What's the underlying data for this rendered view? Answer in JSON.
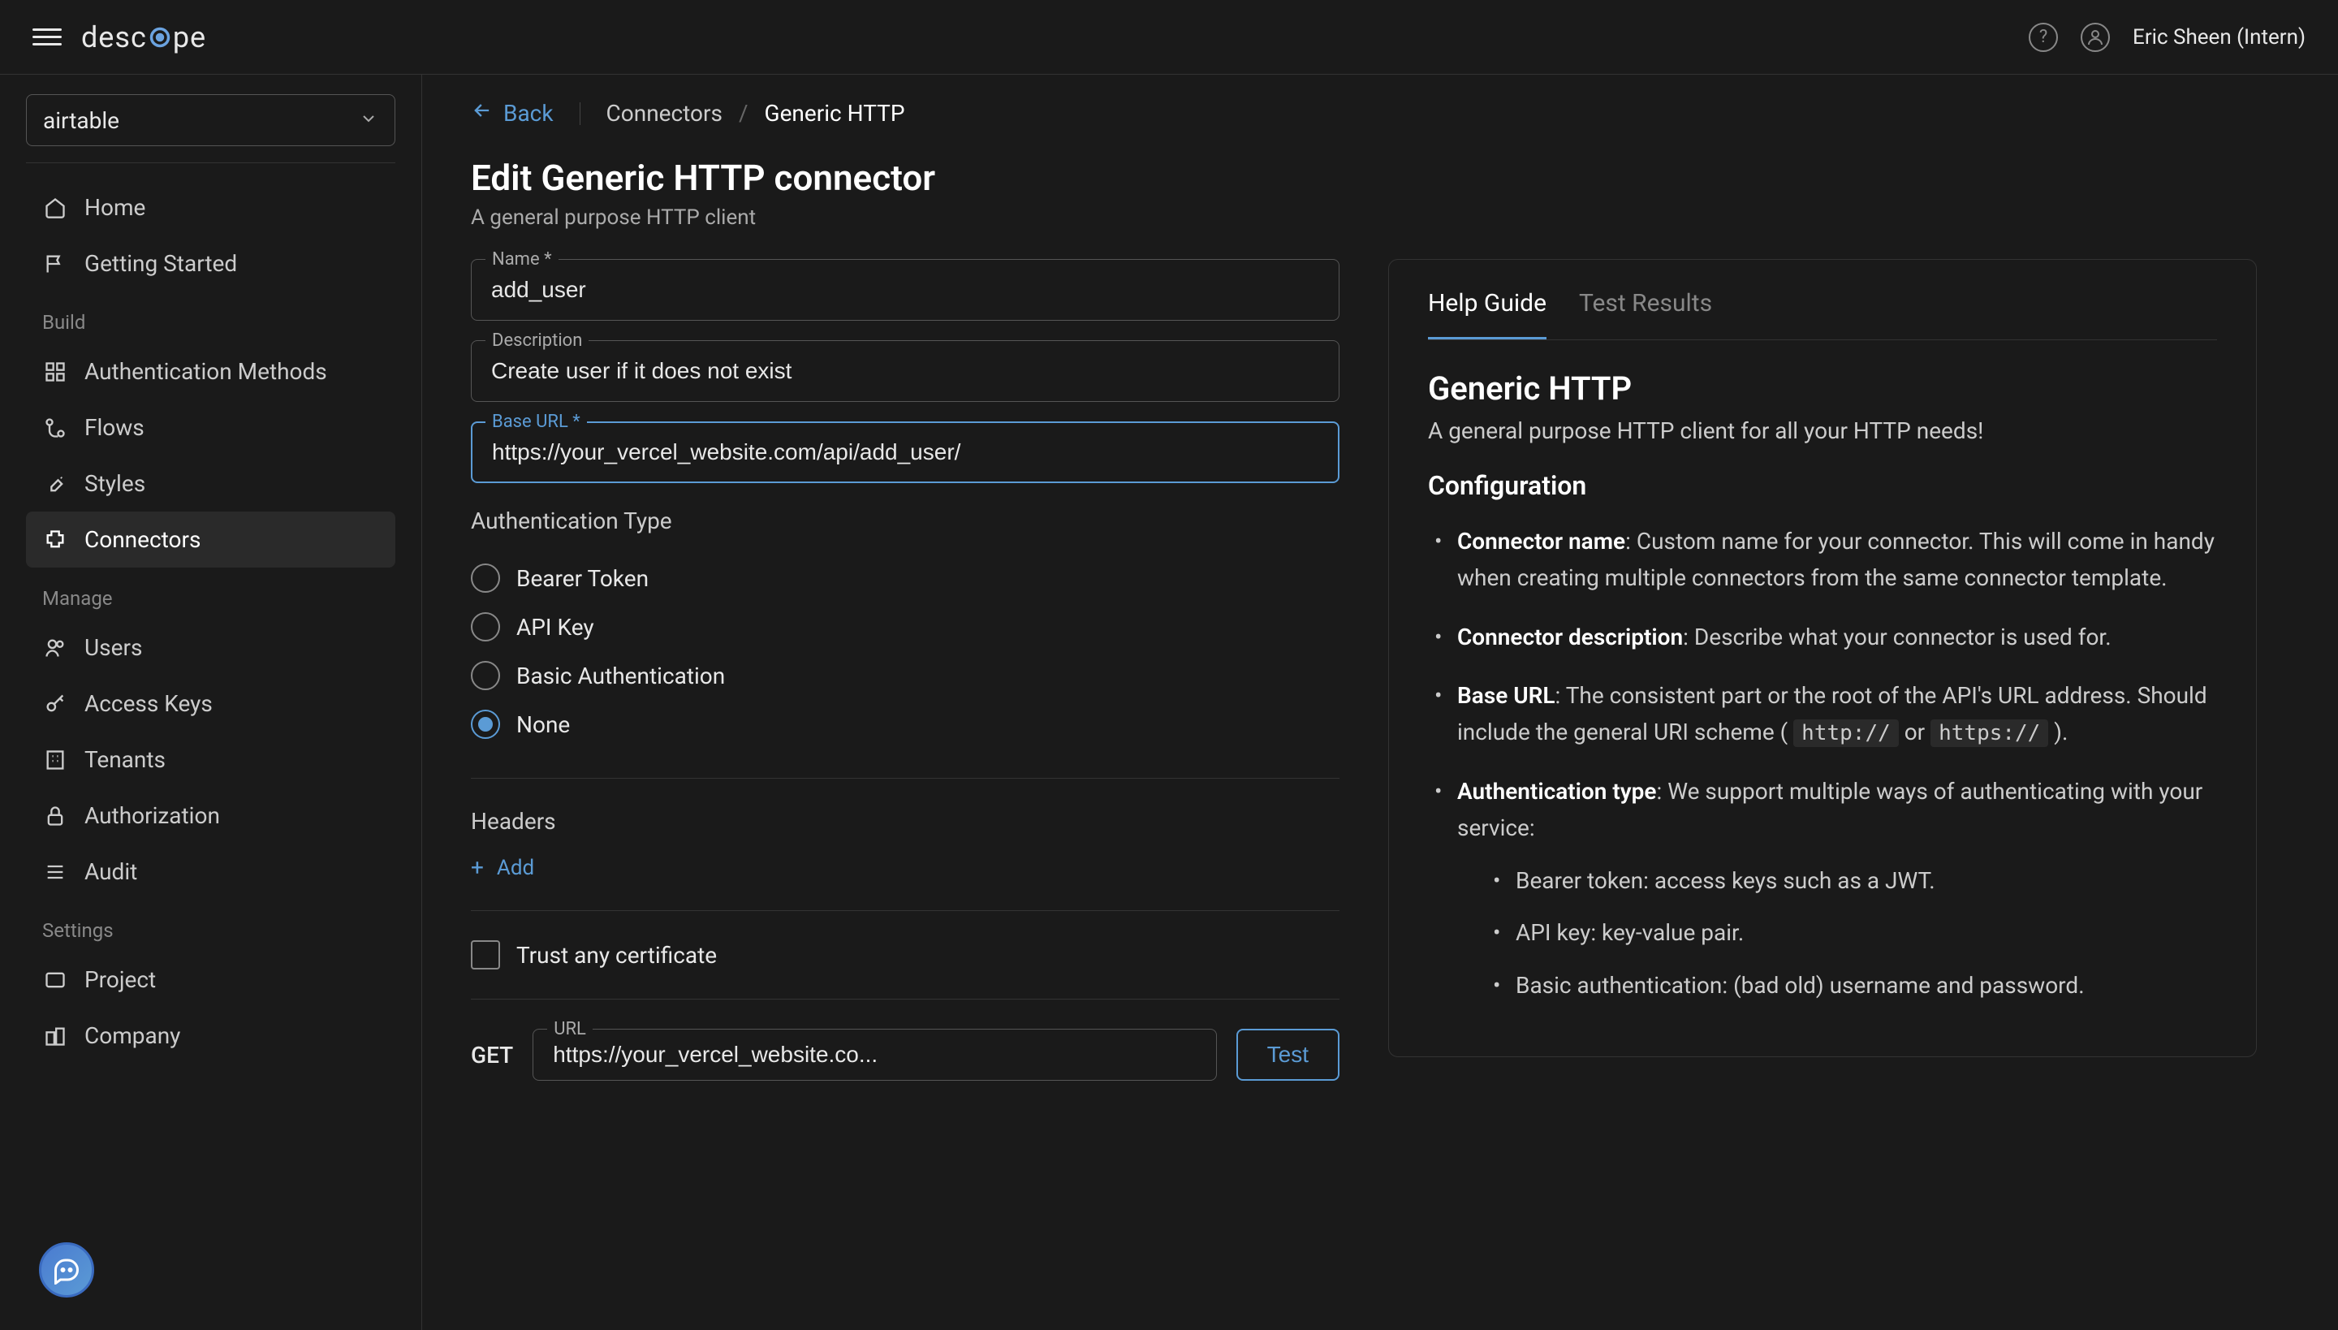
{
  "topbar": {
    "logo_text_pre": "desc",
    "logo_text_post": "pe",
    "username": "Eric Sheen (Intern)"
  },
  "sidebar": {
    "tenant_selected": "airtable",
    "nav_primary": [
      {
        "label": "Home",
        "icon": "home"
      },
      {
        "label": "Getting Started",
        "icon": "flag"
      }
    ],
    "section_build": "Build",
    "nav_build": [
      {
        "label": "Authentication Methods",
        "icon": "grid"
      },
      {
        "label": "Flows",
        "icon": "branch"
      },
      {
        "label": "Styles",
        "icon": "brush"
      },
      {
        "label": "Connectors",
        "icon": "puzzle",
        "active": true
      }
    ],
    "section_manage": "Manage",
    "nav_manage": [
      {
        "label": "Users",
        "icon": "users"
      },
      {
        "label": "Access Keys",
        "icon": "key"
      },
      {
        "label": "Tenants",
        "icon": "building"
      },
      {
        "label": "Authorization",
        "icon": "lock"
      },
      {
        "label": "Audit",
        "icon": "list"
      }
    ],
    "section_settings": "Settings",
    "nav_settings": [
      {
        "label": "Project",
        "icon": "folder"
      },
      {
        "label": "Company",
        "icon": "company"
      }
    ]
  },
  "breadcrumb": {
    "back": "Back",
    "link": "Connectors",
    "slash": "/",
    "current": "Generic HTTP"
  },
  "page": {
    "title": "Edit Generic HTTP connector",
    "subtitle": "A general purpose HTTP client"
  },
  "form": {
    "name_label": "Name *",
    "name_value": "add_user",
    "desc_label": "Description",
    "desc_value": "Create user if it does not exist",
    "baseurl_label": "Base URL *",
    "baseurl_value": "https://your_vercel_website.com/api/add_user/",
    "auth_type_label": "Authentication Type",
    "auth_options": [
      "Bearer Token",
      "API Key",
      "Basic Authentication",
      "None"
    ],
    "auth_selected": "None",
    "headers_label": "Headers",
    "add_label": "Add",
    "trust_cert_label": "Trust any certificate",
    "method": "GET",
    "url_label": "URL",
    "url_value": "https://your_vercel_website.co...",
    "test_btn": "Test"
  },
  "help": {
    "tabs": [
      "Help Guide",
      "Test Results"
    ],
    "active_tab": "Help Guide",
    "title": "Generic HTTP",
    "subtitle": "A general purpose HTTP client for all your HTTP needs!",
    "config_heading": "Configuration",
    "bullets": [
      {
        "term": "Connector name",
        "text": ": Custom name for your connector. This will come in handy when creating multiple connectors from the same connector template."
      },
      {
        "term": "Connector description",
        "text": ": Describe what your connector is used for."
      },
      {
        "term": "Base URL",
        "text_pre": ": The consistent part or the root of the API's URL address. Should include the general URI scheme ( ",
        "code1": "http://",
        "mid": " or ",
        "code2": "https://",
        "text_post": " )."
      },
      {
        "term": "Authentication type",
        "text": ": We support multiple ways of authenticating with your service:"
      }
    ],
    "sub_bullets": [
      "Bearer token: access keys such as a JWT.",
      "API key: key-value pair.",
      "Basic authentication: (bad old) username and password."
    ]
  }
}
